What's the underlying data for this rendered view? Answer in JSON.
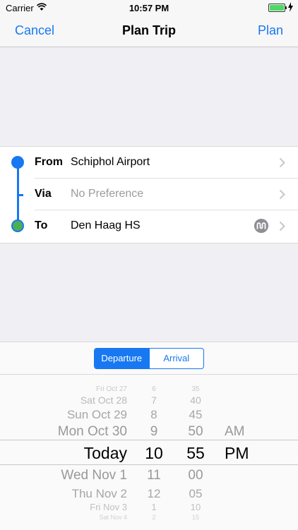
{
  "status_bar": {
    "carrier": "Carrier",
    "time": "10:57 PM"
  },
  "nav": {
    "cancel": "Cancel",
    "title": "Plan Trip",
    "plan": "Plan"
  },
  "route": {
    "from": {
      "label": "From",
      "value": "Schiphol Airport"
    },
    "via": {
      "label": "Via",
      "value": "No Preference"
    },
    "to": {
      "label": "To",
      "value": "Den Haag HS",
      "mode_icon": "metro-icon"
    }
  },
  "segment": {
    "departure": "Departure",
    "arrival": "Arrival",
    "selected": "departure"
  },
  "picker": {
    "dates": [
      "Fri Oct 27",
      "Sat Oct 28",
      "Sun Oct 29",
      "Mon Oct 30",
      "Today",
      "Wed Nov 1",
      "Thu Nov 2",
      "Fri Nov 3",
      "Sat Nov 4"
    ],
    "hours": [
      "6",
      "7",
      "8",
      "9",
      "10",
      "11",
      "12",
      "1",
      "2"
    ],
    "minutes": [
      "35",
      "40",
      "45",
      "50",
      "55",
      "00",
      "05",
      "10",
      "15"
    ],
    "am": "AM",
    "pm": "PM"
  },
  "colors": {
    "accent": "#1778f2",
    "destination_dot": "#4caf50"
  }
}
